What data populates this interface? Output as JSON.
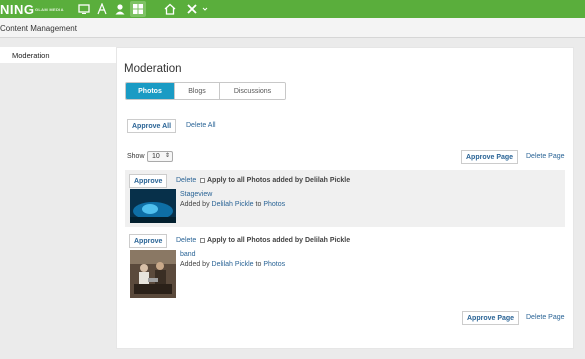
{
  "topbar": {
    "brand": "NING",
    "brand_sub": "GLAM MEDIA",
    "icons": [
      "screen-icon",
      "appearance-icon",
      "person-icon",
      "grid-icon",
      "home-icon",
      "tools-icon"
    ]
  },
  "subbar": {
    "title": "Content Management"
  },
  "sidebar": {
    "items": [
      {
        "label": "Moderation"
      }
    ]
  },
  "main": {
    "title": "Moderation",
    "tabs": [
      {
        "label": "Photos",
        "active": true
      },
      {
        "label": "Blogs",
        "active": false
      },
      {
        "label": "Discussions",
        "active": false
      }
    ],
    "approve_all": "Approve All",
    "delete_all": "Delete All",
    "show_label": "Show",
    "show_value": "10",
    "approve_page": "Approve Page",
    "delete_page": "Delete Page",
    "items": [
      {
        "approve": "Approve",
        "delete": "Delete",
        "apply": "Apply to all Photos added by Delilah Pickle",
        "title": "Stageview",
        "added_by": "Added by",
        "author": "Delilah Pickle",
        "to": "to",
        "section": "Photos"
      },
      {
        "approve": "Approve",
        "delete": "Delete",
        "apply": "Apply to all Photos added by Delilah Pickle",
        "title": "band",
        "added_by": "Added by",
        "author": "Delilah Pickle",
        "to": "to",
        "section": "Photos"
      }
    ]
  },
  "colors": {
    "topbar": "#5aae3c",
    "accent": "#1a9bc4",
    "link": "#2a6496"
  }
}
